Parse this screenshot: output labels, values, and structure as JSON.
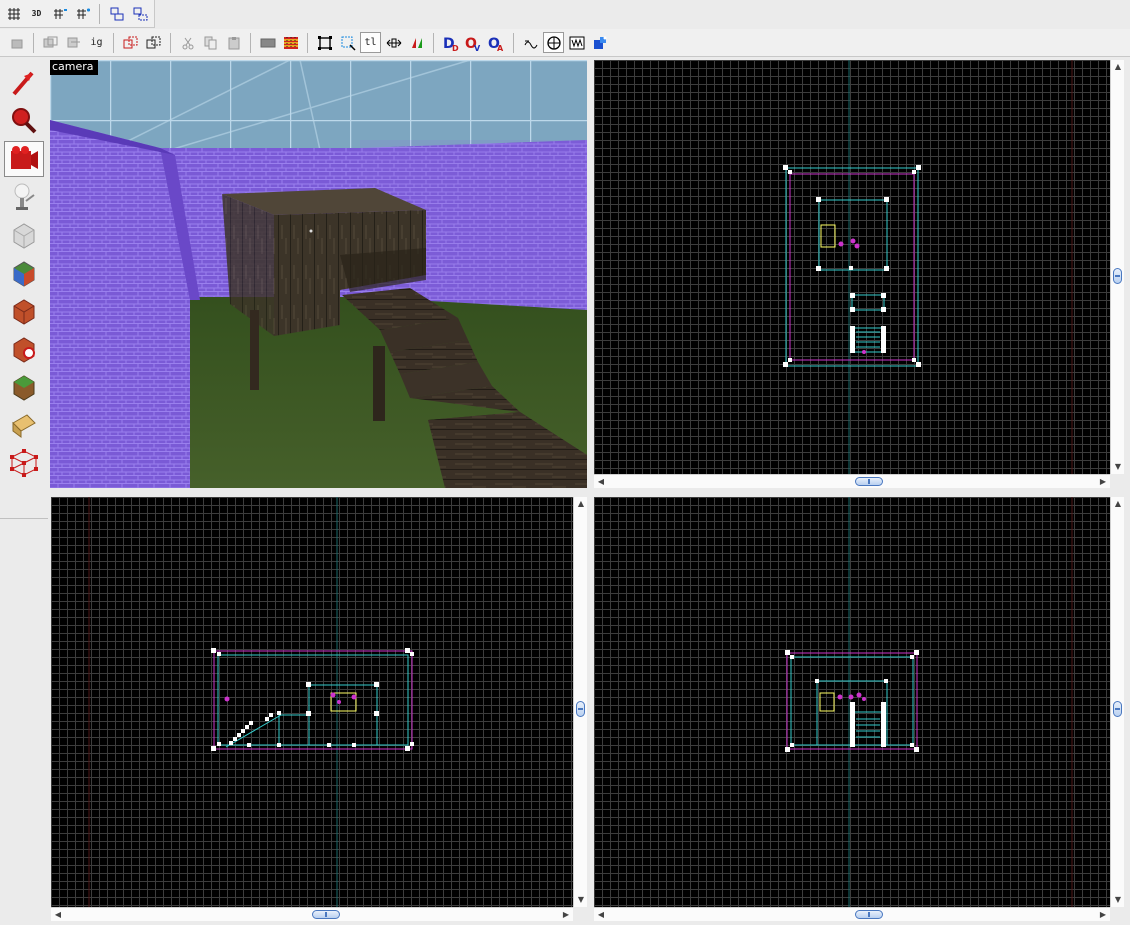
{
  "toolbar_top": {
    "items": [
      {
        "name": "grid-toggle-icon",
        "glyph": "#",
        "label": ""
      },
      {
        "name": "3d-grid-icon",
        "glyph": "3D",
        "label": ""
      },
      {
        "name": "grid-smaller-icon",
        "glyph": "#-",
        "label": ""
      },
      {
        "name": "grid-larger-icon",
        "glyph": "#+",
        "label": ""
      },
      {
        "name": "group-icon",
        "glyph": "⧉",
        "label": ""
      },
      {
        "name": "ungroup-icon",
        "glyph": "⧈",
        "label": ""
      }
    ]
  },
  "toolbar_main": {
    "ignore_group_label": "ig",
    "texture_lock_label": "tl",
    "items": [
      "carve-icon",
      "hollow-icon",
      "clip-icon",
      "ignore-group-icon",
      "group-select-icon",
      "ungroup-select-icon",
      "cut-icon",
      "copy-icon",
      "paste-icon",
      "texture-browser-icon",
      "texture-app-icon",
      "select-box-icon",
      "select-object-icon",
      "texture-lock-icon",
      "flip-horizontal-icon",
      "flip-vertical-icon",
      "hide-selected-icon",
      "hide-unselected-icon",
      "show-all-icon",
      "run-map-icon",
      "entity-report-icon",
      "texture-view-icon",
      "options-icon"
    ]
  },
  "tool_palette": {
    "tools": [
      {
        "name": "selection-tool",
        "active": false
      },
      {
        "name": "magnify-tool",
        "active": false
      },
      {
        "name": "camera-tool",
        "active": true
      },
      {
        "name": "entity-tool",
        "active": false
      },
      {
        "name": "block-tool",
        "active": false
      },
      {
        "name": "texture-application-tool",
        "active": false
      },
      {
        "name": "apply-current-texture-tool",
        "active": false
      },
      {
        "name": "decal-tool",
        "active": false
      },
      {
        "name": "overlay-tool",
        "active": false
      },
      {
        "name": "clipping-tool",
        "active": false
      },
      {
        "name": "vertex-tool",
        "active": false
      }
    ]
  },
  "viewports": {
    "camera": {
      "label": "camera"
    },
    "top": {
      "label": ""
    },
    "front": {
      "label": ""
    },
    "side": {
      "label": ""
    }
  },
  "colors": {
    "grid_line": "#404040",
    "grid_bg": "#000000",
    "brush_outline": "#cc33cc",
    "brush_inner": "#33cccc",
    "handle": "#ffffff",
    "selected": "#ffff66",
    "axis_line": "#1a6a6a",
    "wall_purple": "#7a5ad6",
    "sky": "#7da6c0",
    "grass": "#3e5a24",
    "wood": "#3c3428"
  }
}
